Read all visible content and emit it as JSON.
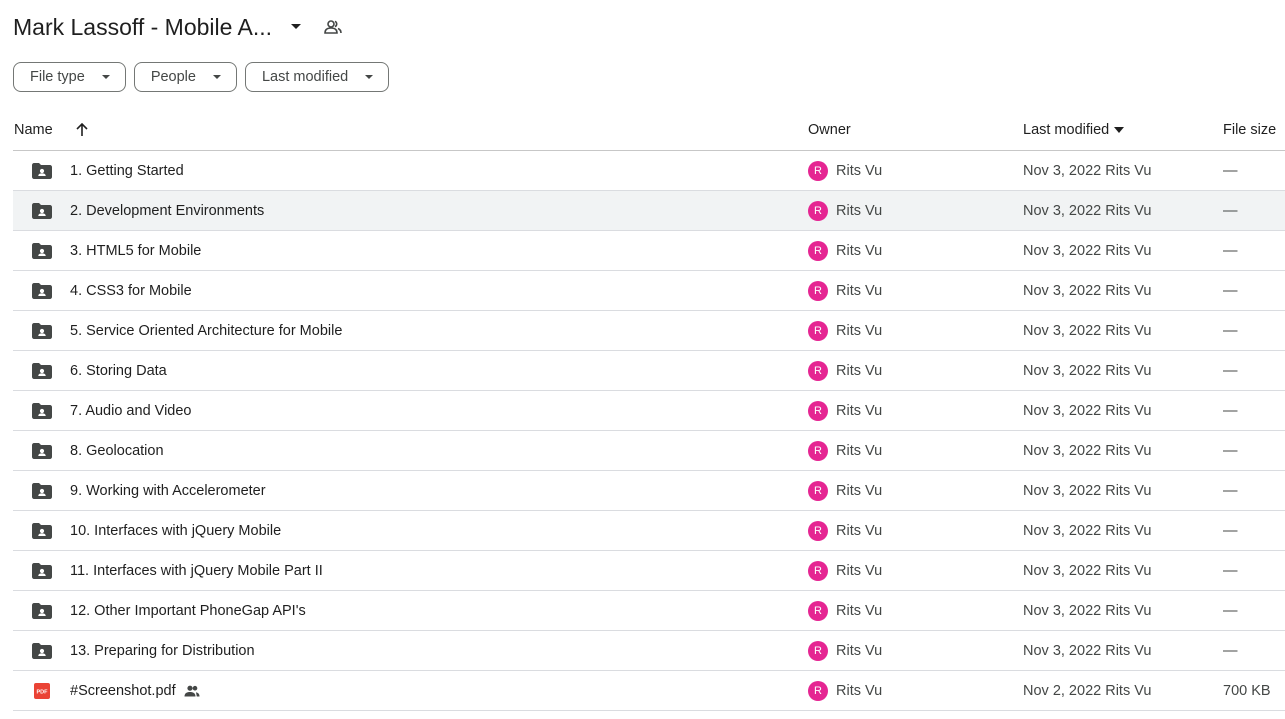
{
  "header": {
    "title": "Mark Lassoff - Mobile A..."
  },
  "filters": [
    {
      "label": "File type"
    },
    {
      "label": "People"
    },
    {
      "label": "Last modified"
    }
  ],
  "columns": {
    "name": "Name",
    "owner": "Owner",
    "modified": "Last modified",
    "size": "File size"
  },
  "rows": [
    {
      "name": "1. Getting Started",
      "owner_initial": "R",
      "owner": "Rits Vu",
      "modified": "Nov 3, 2022 Rits Vu",
      "size": "—",
      "type": "folder"
    },
    {
      "name": "2. Development Environments",
      "owner_initial": "R",
      "owner": "Rits Vu",
      "modified": "Nov 3, 2022 Rits Vu",
      "size": "—",
      "type": "folder"
    },
    {
      "name": "3. HTML5 for Mobile",
      "owner_initial": "R",
      "owner": "Rits Vu",
      "modified": "Nov 3, 2022 Rits Vu",
      "size": "—",
      "type": "folder"
    },
    {
      "name": "4. CSS3 for Mobile",
      "owner_initial": "R",
      "owner": "Rits Vu",
      "modified": "Nov 3, 2022 Rits Vu",
      "size": "—",
      "type": "folder"
    },
    {
      "name": "5. Service Oriented Architecture for Mobile",
      "owner_initial": "R",
      "owner": "Rits Vu",
      "modified": "Nov 3, 2022 Rits Vu",
      "size": "—",
      "type": "folder"
    },
    {
      "name": "6. Storing Data",
      "owner_initial": "R",
      "owner": "Rits Vu",
      "modified": "Nov 3, 2022 Rits Vu",
      "size": "—",
      "type": "folder"
    },
    {
      "name": "7. Audio and Video",
      "owner_initial": "R",
      "owner": "Rits Vu",
      "modified": "Nov 3, 2022 Rits Vu",
      "size": "—",
      "type": "folder"
    },
    {
      "name": "8. Geolocation",
      "owner_initial": "R",
      "owner": "Rits Vu",
      "modified": "Nov 3, 2022 Rits Vu",
      "size": "—",
      "type": "folder"
    },
    {
      "name": "9. Working with Accelerometer",
      "owner_initial": "R",
      "owner": "Rits Vu",
      "modified": "Nov 3, 2022 Rits Vu",
      "size": "—",
      "type": "folder"
    },
    {
      "name": "10. Interfaces with jQuery Mobile",
      "owner_initial": "R",
      "owner": "Rits Vu",
      "modified": "Nov 3, 2022 Rits Vu",
      "size": "—",
      "type": "folder"
    },
    {
      "name": "11. Interfaces with jQuery Mobile Part II",
      "owner_initial": "R",
      "owner": "Rits Vu",
      "modified": "Nov 3, 2022 Rits Vu",
      "size": "—",
      "type": "folder"
    },
    {
      "name": "12. Other Important PhoneGap API's",
      "owner_initial": "R",
      "owner": "Rits Vu",
      "modified": "Nov 3, 2022 Rits Vu",
      "size": "—",
      "type": "folder"
    },
    {
      "name": "13. Preparing for Distribution",
      "owner_initial": "R",
      "owner": "Rits Vu",
      "modified": "Nov 3, 2022 Rits Vu",
      "size": "—",
      "type": "folder"
    },
    {
      "name": "#Screenshot.pdf",
      "owner_initial": "R",
      "owner": "Rits Vu",
      "modified": "Nov 2, 2022 Rits Vu",
      "size": "700 KB",
      "type": "pdf",
      "pdf_badge": "PDF"
    }
  ]
}
